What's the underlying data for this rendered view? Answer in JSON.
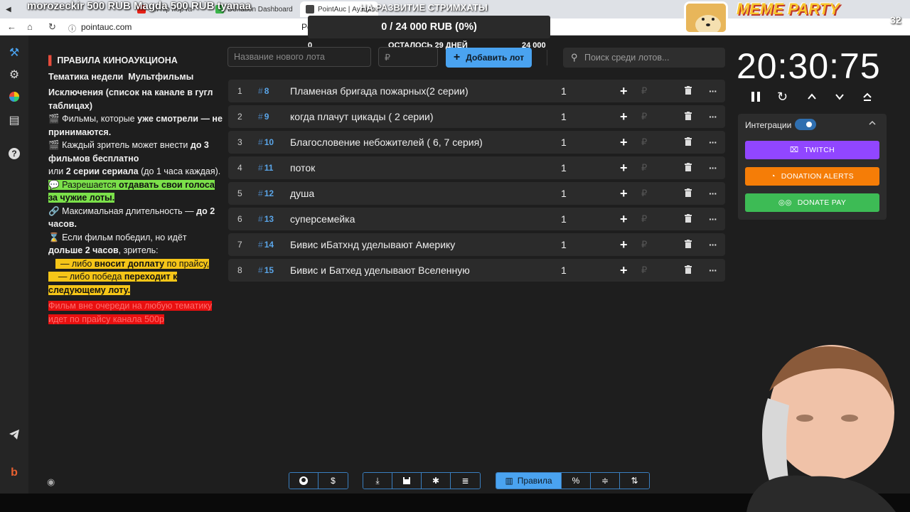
{
  "browser": {
    "tabs": [
      {
        "label": "morozeckir",
        "color": "#2b2b2b"
      },
      {
        "label": "lofi hip hop radio",
        "color": "#e62117"
      },
      {
        "label": "Magda",
        "color": "#9146ff"
      },
      {
        "label": "Donation Dashboard",
        "color": "#3bb44a"
      },
      {
        "label": "PointAuc | Аукцион",
        "color": "#444444"
      }
    ],
    "ticker": "morozeckir 500 RUB     Magda 500 RUB     tyanaa",
    "url": "pointauc.com",
    "url_po": "Po",
    "stream_banner": "НА РАЗВИТИЕ СТРИМХАТЫ"
  },
  "progress": {
    "value_text": "0 / 24 000 RUB (0%)",
    "min_label": "0",
    "remaining_label": "ОСТАЛОСЬ 29 ДНЕЙ",
    "max_label": "24 000"
  },
  "rules": {
    "title": "ПРАВИЛА КИНОАУКЦИОНА",
    "theme_label": "Тематика недели",
    "theme_value": "Мультфильмы",
    "exceptions": "Исключения (список на канале в гугл таблицах)",
    "watched_prefix": "Фильмы, которые ",
    "watched_bold": "уже смотрели — не принимаются.",
    "viewer_prefix": "Каждый зритель может внести ",
    "viewer_bold": "до 3 фильмов бесплатно",
    "viewer_or": "или ",
    "viewer_series_bold": "2 серии сериала",
    "viewer_series_rest": " (до 1 часа каждая).",
    "votes_prefix": "Разрешается ",
    "votes_bold": "отдавать свои голоса за чужие лоты.",
    "maxlen_prefix": "Максимальная длительность — ",
    "maxlen_bold": "до 2 часов.",
    "win_prefix": "Если фильм победил, но идёт ",
    "win_bold": "дольше 2 часов",
    "win_rest": ", зритель:",
    "pay_prefix": "— либо ",
    "pay_bold": "вносит доплату",
    "pay_rest": " по прайсу,",
    "next_prefix": "— либо победа ",
    "next_bold": "переходит к следующему лоту.",
    "outofturn": "Фильм вне очереди на любую тематику идет по прайсу канала 500р"
  },
  "form": {
    "lot_placeholder": "Название нового лота",
    "amount_placeholder": "₽",
    "add_label": "Добавить лот",
    "search_placeholder": "Поиск среди лотов..."
  },
  "lots": [
    {
      "index": "1",
      "id": "8",
      "name": "Пламеная бригада пожарных(2 серии)",
      "amount": "1"
    },
    {
      "index": "2",
      "id": "9",
      "name": "когда плачут цикады ( 2 серии)",
      "amount": "1"
    },
    {
      "index": "3",
      "id": "10",
      "name": " Благословение небожителей ( 6, 7 серия)",
      "amount": "1"
    },
    {
      "index": "4",
      "id": "11",
      "name": "поток",
      "amount": "1"
    },
    {
      "index": "5",
      "id": "12",
      "name": "душа",
      "amount": "1"
    },
    {
      "index": "6",
      "id": "13",
      "name": "суперсемейка",
      "amount": "1"
    },
    {
      "index": "7",
      "id": "14",
      "name": "Бивис иБатхнд уделывают Америку",
      "amount": "1"
    },
    {
      "index": "8",
      "id": "15",
      "name": "Бивис и Батхед уделывают Вселенную",
      "amount": "1"
    }
  ],
  "timer": {
    "value": "20:30:75"
  },
  "integrations": {
    "label": "Интеграции",
    "enabled": true,
    "twitch": {
      "label": "TWITCH",
      "color": "#9146ff"
    },
    "donation_alerts": {
      "label": "DONATION ALERTS",
      "color": "#f57d07"
    },
    "donate_pay": {
      "label": "DONATE PAY",
      "color": "#3dbb55"
    }
  },
  "toolbar": {
    "rules_label": "Правила"
  },
  "overlay": {
    "meme_party": "MEME PARTY",
    "counter": "32"
  },
  "colors": {
    "accent": "#4aa3f0",
    "background": "#1e1e1e",
    "lot_bg": "#2b2b2b",
    "highlight_green": "#7be04a",
    "highlight_yellow": "#f5c518",
    "highlight_red": "#e81010"
  }
}
